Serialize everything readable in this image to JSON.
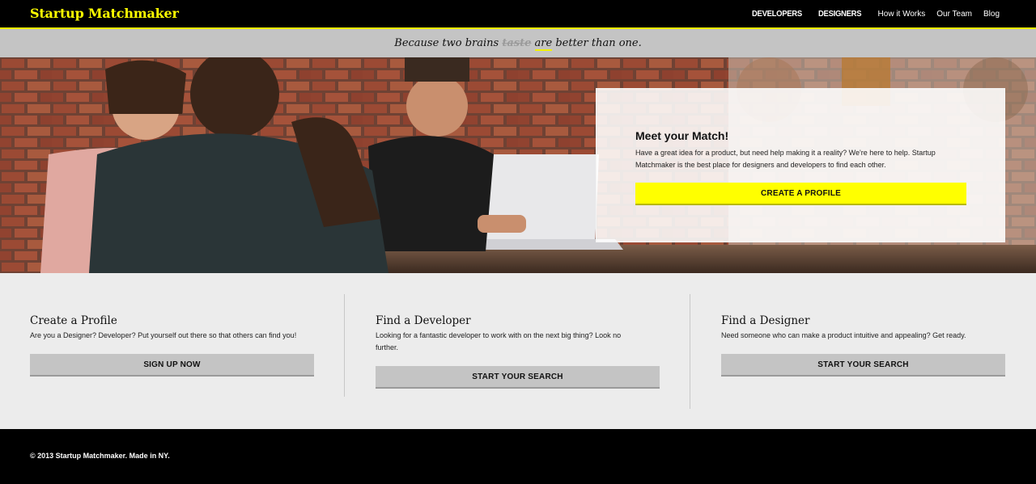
{
  "header": {
    "brand": "Startup Matchmaker",
    "nav": [
      {
        "label": "DEVELOPERS"
      },
      {
        "label": "DESIGNERS"
      },
      {
        "label": "How it Works"
      },
      {
        "label": "Our Team"
      },
      {
        "label": "Blog"
      }
    ],
    "accent_color": "#ffff00"
  },
  "tagline": {
    "before": "Because two brains",
    "struck": "taste",
    "underlined": "are",
    "after": "better than one."
  },
  "hero": {
    "card_title": "Meet your Match!",
    "card_text": "Have a great idea for a product, but need help making it a reality? We're here to help. Startup Matchmaker is the best place for designers and developers to find each other.",
    "cta_label": "CREATE A PROFILE"
  },
  "features": [
    {
      "title": "Create a Profile",
      "text": "Are you a Designer? Developer? Put yourself out there so that others can find you!",
      "button": "SIGN UP NOW"
    },
    {
      "title": "Find a Developer",
      "text": "Looking for a fantastic developer to work with on the next big thing? Look no further.",
      "button": "START YOUR SEARCH"
    },
    {
      "title": "Find a Designer",
      "text": "Need someone who can make a product intuitive and appealing? Get ready.",
      "button": "START YOUR SEARCH"
    }
  ],
  "footer": {
    "text": "© 2013 Startup Matchmaker. Made in NY."
  }
}
